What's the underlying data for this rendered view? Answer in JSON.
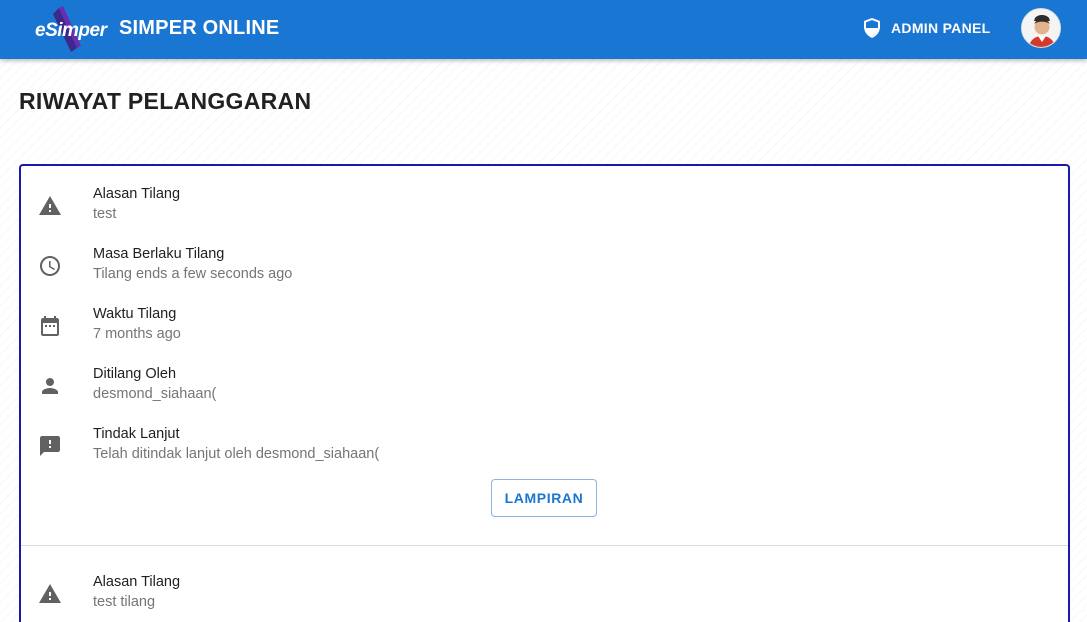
{
  "header": {
    "logo_text": "eSimper",
    "title": "SIMPER ONLINE",
    "admin_label": "ADMIN PANEL",
    "brand_color": "#1976d2"
  },
  "page": {
    "title": "RIWAYAT PELANGGARAN"
  },
  "violations": [
    {
      "items": [
        {
          "icon": "warning-icon",
          "label": "Alasan Tilang",
          "value": "test"
        },
        {
          "icon": "clock-icon",
          "label": "Masa Berlaku Tilang",
          "value": "Tilang ends a few seconds ago"
        },
        {
          "icon": "calendar-icon",
          "label": "Waktu Tilang",
          "value": "7 months ago"
        },
        {
          "icon": "person-icon",
          "label": "Ditilang Oleh",
          "value": "desmond_siahaan("
        },
        {
          "icon": "feedback-icon",
          "label": "Tindak Lanjut",
          "value": "Telah ditindak lanjut oleh desmond_siahaan("
        }
      ],
      "attachment_label": "LAMPIRAN"
    },
    {
      "items": [
        {
          "icon": "warning-icon",
          "label": "Alasan Tilang",
          "value": "test tilang"
        }
      ]
    }
  ]
}
